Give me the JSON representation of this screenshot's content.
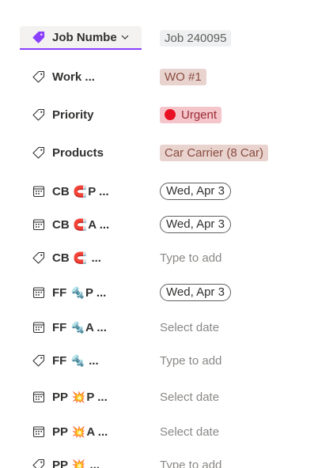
{
  "fields": [
    {
      "icon": "tag-filled-icon",
      "label": "Job Numbe",
      "emoji": "",
      "suffix": "",
      "value_type": "tag-grey",
      "value": "Job 240095",
      "active": true
    },
    {
      "icon": "tag-icon",
      "label": "Work ...",
      "emoji": "",
      "suffix": "",
      "value_type": "tag-pink",
      "value": "WO #1"
    },
    {
      "icon": "tag-icon",
      "label": "Priority",
      "emoji": "",
      "suffix": "",
      "value_type": "tag-red",
      "value": "Urgent"
    },
    {
      "icon": "tag-icon",
      "label": "Products",
      "emoji": "",
      "suffix": "",
      "value_type": "tag-pink",
      "value": "Car Carrier (8 Car)"
    },
    {
      "icon": "calendar-icon",
      "label": "CB",
      "emoji": "🧲",
      "suffix": "P ...",
      "value_type": "pill",
      "value": "Wed, Apr 3"
    },
    {
      "icon": "calendar-icon",
      "label": "CB",
      "emoji": "🧲",
      "suffix": "A ...",
      "value_type": "pill",
      "value": "Wed, Apr 3"
    },
    {
      "icon": "tag-icon",
      "label": "CB",
      "emoji": "🧲",
      "suffix": "...",
      "value_type": "placeholder",
      "value": "Type to add"
    },
    {
      "icon": "calendar-icon",
      "label": "FF",
      "emoji": "🔩",
      "suffix": "P ...",
      "value_type": "pill",
      "value": "Wed, Apr 3"
    },
    {
      "icon": "calendar-icon",
      "label": "FF",
      "emoji": "🔩",
      "suffix": "A ...",
      "value_type": "placeholder",
      "value": "Select date"
    },
    {
      "icon": "tag-icon",
      "label": "FF",
      "emoji": "🔩",
      "suffix": "...",
      "value_type": "placeholder",
      "value": "Type to add"
    },
    {
      "icon": "calendar-icon",
      "label": "PP",
      "emoji": "💥",
      "suffix": "P ...",
      "value_type": "placeholder",
      "value": "Select date"
    },
    {
      "icon": "calendar-icon",
      "label": "PP",
      "emoji": "💥",
      "suffix": "A ...",
      "value_type": "placeholder",
      "value": "Select date"
    },
    {
      "icon": "tag-icon",
      "label": "PP",
      "emoji": "💥",
      "suffix": "...",
      "value_type": "placeholder",
      "value": "Type to add"
    }
  ],
  "colors": {
    "accent": "#8a3ffc",
    "urgent_dot": "#e81123",
    "tag_pink_bg": "#e8d3cf",
    "tag_red_bg": "#f4c6cb",
    "tag_grey_bg": "#eef0f1"
  }
}
